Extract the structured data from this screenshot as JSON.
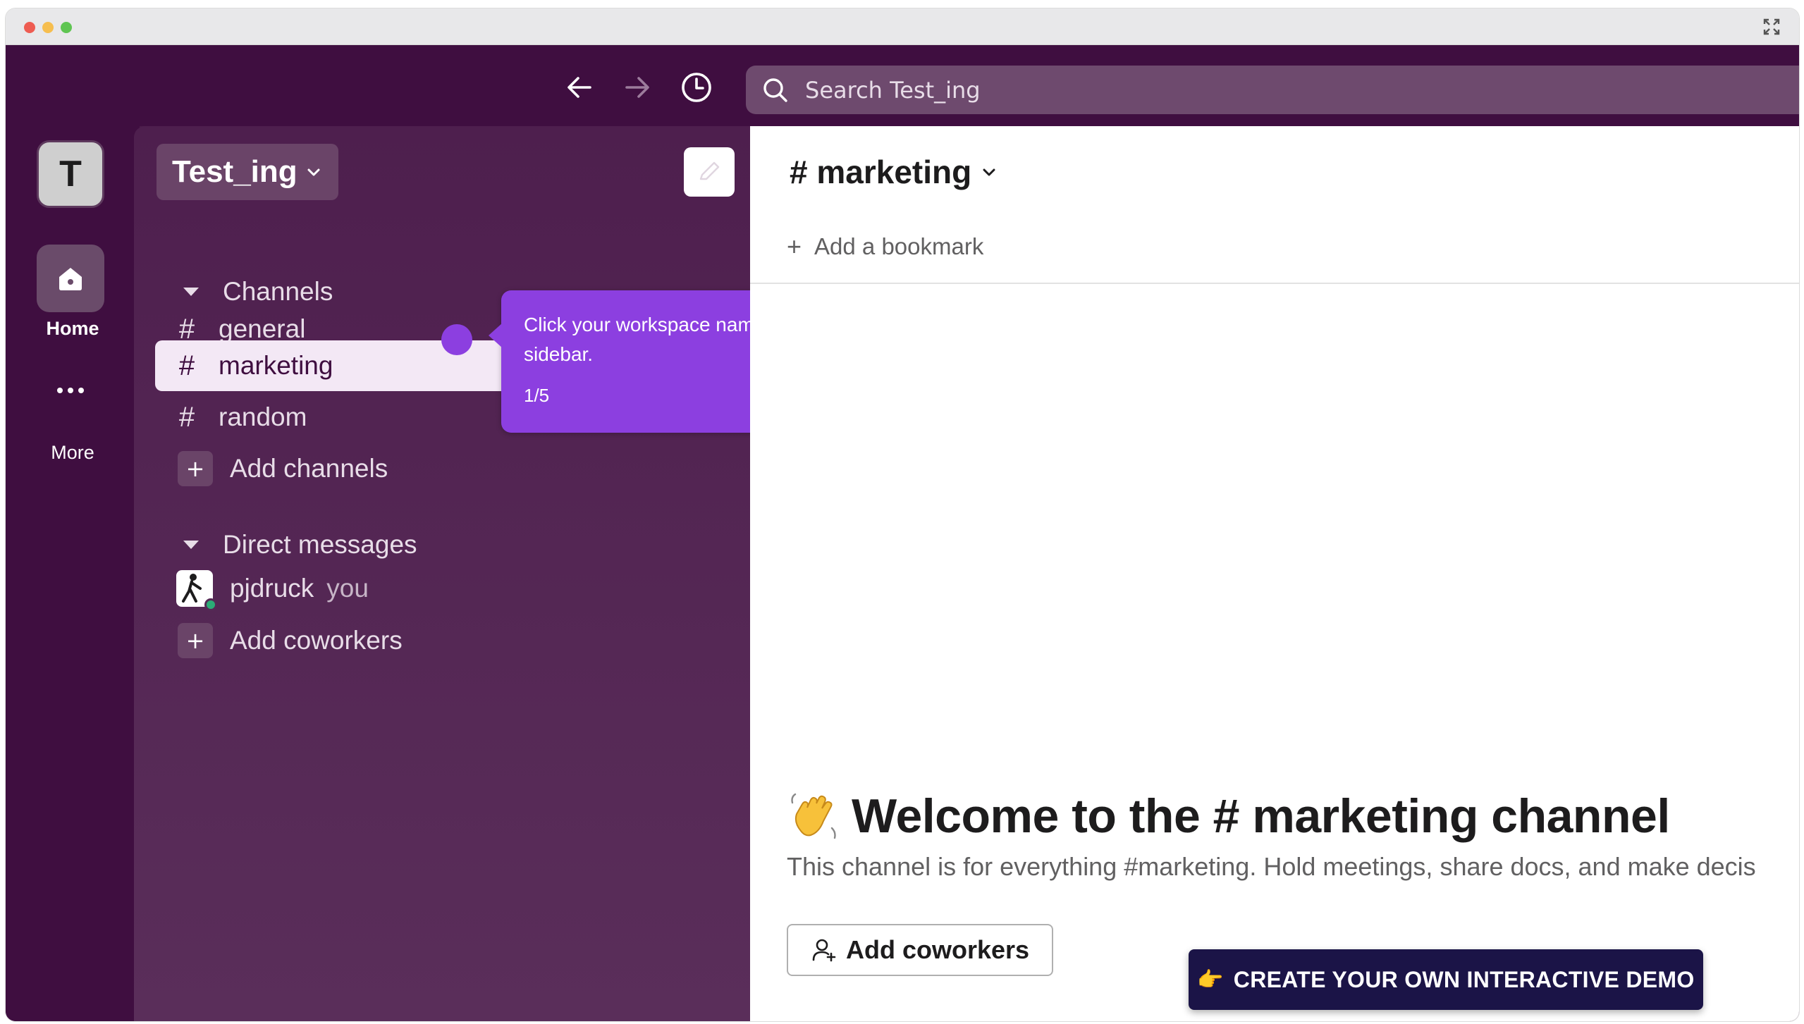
{
  "titlebar": {
    "controls": [
      "close",
      "minimize",
      "maximize"
    ],
    "expand_icon": "expand-icon"
  },
  "toolbar": {
    "back_icon": "arrow-left-icon",
    "forward_icon": "arrow-right-icon",
    "history_icon": "clock-icon",
    "search_placeholder": "Search Test_ing"
  },
  "rail": {
    "workspace_initial": "T",
    "home_label": "Home",
    "more_label": "More"
  },
  "sidebar": {
    "workspace_name": "Test_ing",
    "channels_header": "Channels",
    "channels": [
      {
        "hash": "#",
        "label": "general",
        "active": false
      },
      {
        "hash": "#",
        "label": "marketing",
        "active": true
      },
      {
        "hash": "#",
        "label": "random",
        "active": false
      }
    ],
    "add_channels": "Add channels",
    "dm_header": "Direct messages",
    "dm_user": "pjdruck",
    "dm_you": "you",
    "add_coworkers": "Add coworkers"
  },
  "tooltip": {
    "text": "Click your workspace name in the sidebar.",
    "step": "1/5"
  },
  "main": {
    "channel_title": "# marketing",
    "bookmark_plus": "+",
    "bookmark_label": "Add a bookmark",
    "welcome_title": "Welcome to the # marketing channel",
    "description": "This channel is for everything #marketing. Hold meetings, share docs, and make decis",
    "add_coworkers_button": "Add coworkers"
  },
  "demo_banner": {
    "emoji": "👉",
    "label": "CREATE YOUR OWN INTERACTIVE DEMO"
  },
  "colors": {
    "aubergine": "#3f0e40",
    "sidebar": "#4e1f4e",
    "tooltip": "#8c3fe0",
    "active_item": "#f3e8f5",
    "banner": "#1b1447",
    "presence": "#2bac76"
  }
}
